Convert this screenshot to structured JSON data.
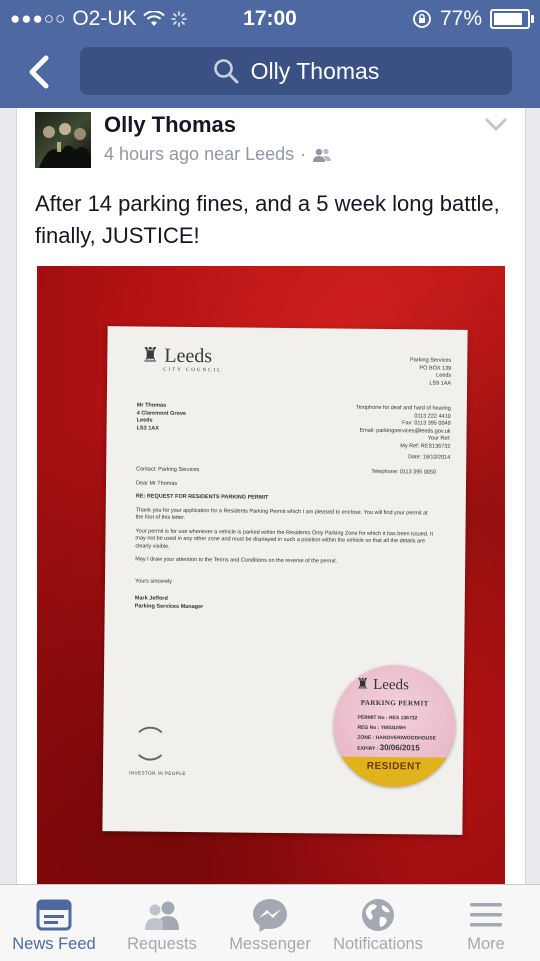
{
  "status": {
    "carrier": "O2-UK",
    "time": "17:00",
    "battery": "77%",
    "battery_level": 0.77
  },
  "header": {
    "search_text": "Olly Thomas"
  },
  "post": {
    "author": "Olly Thomas",
    "timestamp": "4 hours ago near Leeds",
    "separator": "·",
    "privacy_icon": "friends-icon",
    "text": "After 14 parking fines, and a 5 week long battle, finally, JUSTICE!",
    "photo": {
      "letter": {
        "logo": "Leeds",
        "logo_sub": "CITY COUNCIL",
        "sender_address": [
          "Parking Services",
          "PO BOX 139",
          "Leeds",
          "LS9 1AA"
        ],
        "recipient_address": [
          "Mr Thomas",
          "4 Claremont Grove",
          "Leeds",
          "LS3 1AX"
        ],
        "contact_lines": [
          "Textphone for deaf and hard of hearing",
          "0113 222 4410",
          "Fax: 0113 395 0049",
          "Email: parkingservices@leeds.gov.uk",
          "Your Ref:",
          "My Ref: RES136732",
          "Date: 18/10/2014",
          "Telephone: 0113 395 0050"
        ],
        "contact": "Contact: Parking Services",
        "salutation": "Dear Mr Thomas",
        "subject": "RE:   REQUEST FOR RESIDENTS PARKING PERMIT",
        "para1": "Thank you for your application for a Residents Parking Permit which I am pleased to enclose. You will find your permit at the foot of this letter.",
        "para2": "Your permit is for use whenever a vehicle is parked within the Residents Only Parking Zone for which it has been issued. It may not be used in any other zone and must be displayed in such a position within the vehicle so that all the details are clearly visible.",
        "para3": "May I draw your attention to the Terms and Conditions on the reverse of the permit.",
        "closing": "Yours sincerely",
        "signatory": "Mark Jefford",
        "signatory_title": "Parking Services Manager",
        "iip": "INVESTOR IN PEOPLE"
      },
      "permit": {
        "logo": "Leeds",
        "title": "PARKING PERMIT",
        "permit_no": "PERMIT No : RES 136732",
        "reg_no": "REG No : YM53UWH",
        "zone": "ZONE : HANOVER/WOODHOUSE",
        "expiry_label": "EXPIRY :",
        "expiry": "30/06/2015",
        "band": "RESIDENT"
      }
    }
  },
  "tabs": [
    {
      "label": "News Feed",
      "icon": "news-feed-icon",
      "active": true
    },
    {
      "label": "Requests",
      "icon": "friend-requests-icon",
      "active": false
    },
    {
      "label": "Messenger",
      "icon": "messenger-icon",
      "active": false
    },
    {
      "label": "Notifications",
      "icon": "globe-icon",
      "active": false
    },
    {
      "label": "More",
      "icon": "menu-icon",
      "active": false
    }
  ],
  "colors": {
    "brand": "#4e69a2",
    "tab_inactive": "#a3a8b3",
    "meta_text": "#9197a3"
  }
}
